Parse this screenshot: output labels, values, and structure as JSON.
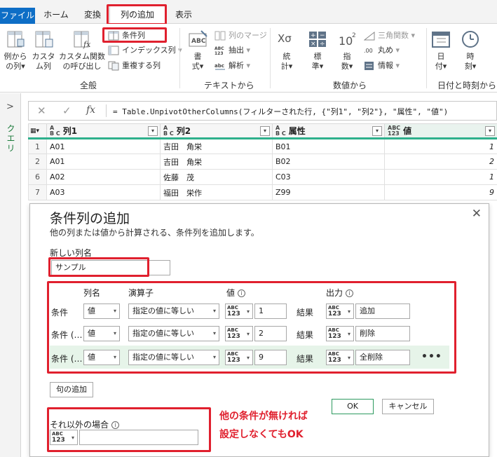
{
  "ribbon_tabs": {
    "file": "ファイル",
    "home": "ホーム",
    "transform": "変換",
    "add_column": "列の追加",
    "view": "表示"
  },
  "ribbon": {
    "general": {
      "label": "全般",
      "col_from_examples": [
        "例から",
        "の列"
      ],
      "custom_column": [
        "カスタ",
        "ム列"
      ],
      "invoke_custom_function": [
        "カスタム関数",
        "の呼び出し"
      ],
      "conditional_column": "条件列",
      "index_column": "インデックス列",
      "duplicate_column": "重複する列"
    },
    "text": {
      "label": "テキストから",
      "format": [
        "書",
        "式"
      ],
      "merge_columns": "列のマージ",
      "extract": "抽出",
      "parse": "解析"
    },
    "number": {
      "label": "数値から",
      "statistics": [
        "統",
        "計"
      ],
      "standard": [
        "標",
        "準"
      ],
      "scientific": [
        "指",
        "数"
      ],
      "trigonometry": "三角関数",
      "rounding": "丸め",
      "information": "情報"
    },
    "datetime": {
      "label": "日付と時刻から",
      "date": [
        "日",
        "付"
      ],
      "time": [
        "時",
        "刻"
      ]
    }
  },
  "left_pane": {
    "label": "クエリ"
  },
  "formula_bar": {
    "fx": "fx",
    "formula": "= Table.UnpivotOtherColumns(フィルターされた行, {\"列1\", \"列2\"}, \"属性\", \"値\")"
  },
  "grid": {
    "columns": [
      {
        "type_top": "A",
        "type_bottom": "B C",
        "name": "列1"
      },
      {
        "type_top": "A",
        "type_bottom": "B C",
        "name": "列2"
      },
      {
        "type_top": "A",
        "type_bottom": "B C",
        "name": "属性"
      },
      {
        "type_top": "ABC",
        "type_bottom": "123",
        "name": "値"
      }
    ],
    "rows": [
      {
        "idx": "1",
        "c1": "A01",
        "c2": "吉田　角栄",
        "c3": "B01",
        "c4": "1"
      },
      {
        "idx": "2",
        "c1": "A01",
        "c2": "吉田　角栄",
        "c3": "B02",
        "c4": "2"
      },
      {
        "idx": "6",
        "c1": "A02",
        "c2": "佐藤　茂",
        "c3": "C03",
        "c4": "1"
      },
      {
        "idx": "7",
        "c1": "A03",
        "c2": "福田　栄作",
        "c3": "Z99",
        "c4": "9"
      }
    ]
  },
  "dialog": {
    "title": "条件列の追加",
    "description": "他の列または値から計算される、条件列を追加します。",
    "new_column_label": "新しい列名",
    "new_column_value": "サンプル",
    "headers": {
      "column_name": "列名",
      "operator": "演算子",
      "value": "値",
      "output": "出力"
    },
    "type_abc": "ABC",
    "type_123": "123",
    "then_label": "結果",
    "clauses": [
      {
        "label": "条件",
        "column": "値",
        "operator": "指定の値に等しい",
        "value": "1",
        "output": "追加"
      },
      {
        "label": "条件 (…",
        "column": "値",
        "operator": "指定の値に等しい",
        "value": "2",
        "output": "削除"
      },
      {
        "label": "条件 (…",
        "column": "値",
        "operator": "指定の値に等しい",
        "value": "9",
        "output": "全削除"
      }
    ],
    "more": "•••",
    "add_clause": "句の追加",
    "else_label": "それ以外の場合",
    "else_value": "",
    "ok": "OK",
    "cancel": "キャンセル",
    "annotation": [
      "他の条件が無ければ",
      "設定しなくてもOK"
    ]
  },
  "colors": {
    "file_tab": "#0e6ec6",
    "highlight_red": "#e0202e",
    "grid_accent": "#2eb08c",
    "row_highlight": "#e6f4e9"
  }
}
